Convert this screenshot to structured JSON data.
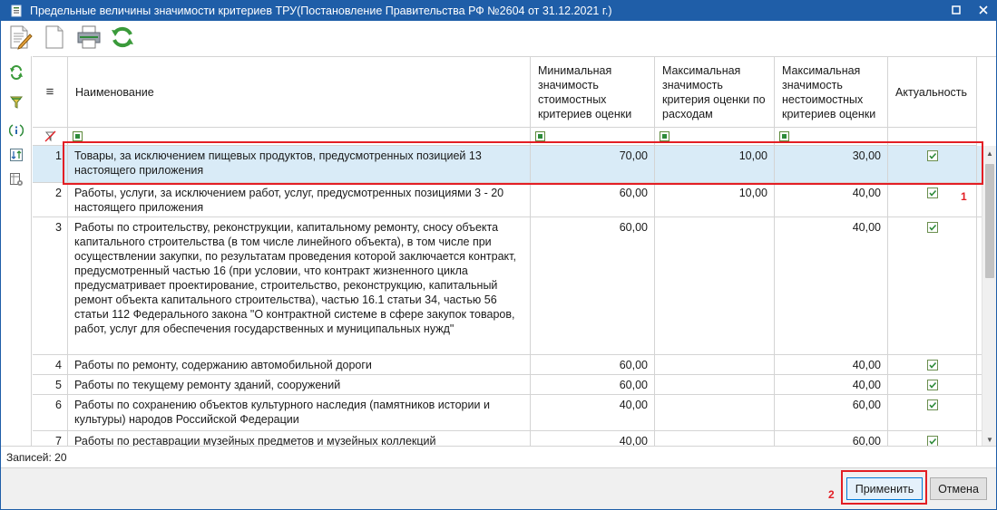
{
  "window": {
    "title": "Предельные величины значимости критериев ТРУ(Постановление Правительства РФ №2604 от 31.12.2021 г.)"
  },
  "toolbar": {
    "icons": [
      "edit-document-icon",
      "new-document-icon",
      "print-icon",
      "refresh-icon"
    ]
  },
  "side_tools": {
    "icons": [
      "refresh-icon",
      "filter-icon",
      "info-icon",
      "sort-icon",
      "column-settings-icon"
    ]
  },
  "grid": {
    "columns": {
      "menu": "≡",
      "name": "Наименование",
      "min_cost": "Минимальная значимость стоимостных критериев оценки",
      "max_expense": "Максимальная значимость критерия оценки по расходам",
      "max_noncost": "Максимальная значимость нестоимостных критериев оценки",
      "actual": "Актуальность"
    },
    "rows": [
      {
        "idx": "1",
        "name": "Товары, за исключением пищевых продуктов, предусмотренных позицией 13 настоящего приложения",
        "min_cost": "70,00",
        "max_expense": "10,00",
        "max_noncost": "30,00",
        "actual": true
      },
      {
        "idx": "2",
        "name": "Работы, услуги, за исключением работ, услуг, предусмотренных позициями 3 - 20 настоящего приложения",
        "min_cost": "60,00",
        "max_expense": "10,00",
        "max_noncost": "40,00",
        "actual": true
      },
      {
        "idx": "3",
        "name": "Работы по строительству, реконструкции, капитальному ремонту, сносу объекта капитального строительства (в том числе линейного объекта), в том числе при осуществлении закупки, по результатам проведения которой заключается контракт, предусмотренный частью 16 (при условии, что контракт жизненного цикла предусматривает проектирование, строительство, реконструкцию, капитальный ремонт объекта капитального строительства), частью 16.1 статьи 34, частью 56 статьи 112 Федерального закона \"О контрактной системе в сфере закупок товаров, работ, услуг для обеспечения государственных и муниципальных нужд\"",
        "min_cost": "60,00",
        "max_expense": "",
        "max_noncost": "40,00",
        "actual": true
      },
      {
        "idx": "4",
        "name": "Работы по ремонту, содержанию автомобильной дороги",
        "min_cost": "60,00",
        "max_expense": "",
        "max_noncost": "40,00",
        "actual": true
      },
      {
        "idx": "5",
        "name": "Работы по текущему ремонту зданий, сооружений",
        "min_cost": "60,00",
        "max_expense": "",
        "max_noncost": "40,00",
        "actual": true
      },
      {
        "idx": "6",
        "name": "Работы по сохранению объектов культурного наследия (памятников истории и культуры) народов Российской Федерации",
        "min_cost": "40,00",
        "max_expense": "",
        "max_noncost": "60,00",
        "actual": true
      },
      {
        "idx": "7",
        "name": "Работы по реставрации музейных предметов и музейных коллекций",
        "min_cost": "40,00",
        "max_expense": "",
        "max_noncost": "60,00",
        "actual": true
      }
    ]
  },
  "status": {
    "records": "Записей: 20"
  },
  "footer": {
    "apply_label": "Применить",
    "cancel_label": "Отмена"
  },
  "annotations": {
    "marker_1": "1",
    "marker_2": "2"
  },
  "colors": {
    "titlebar": "#1f5ea8",
    "selection": "#d9ebf7",
    "highlight": "#e31e24",
    "accent_green": "#2e8b3a"
  }
}
